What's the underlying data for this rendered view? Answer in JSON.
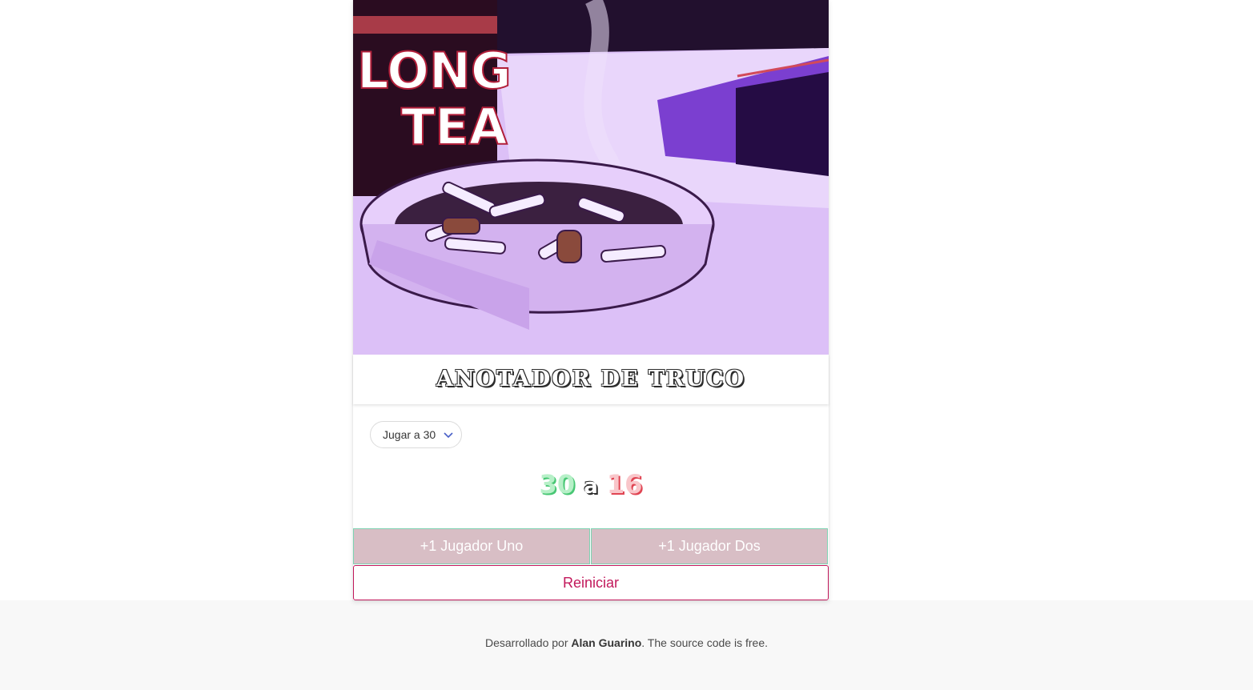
{
  "app": {
    "title": "ANOTADOR DE TRUCO",
    "hero_image_text": [
      "LONG",
      "TEA"
    ]
  },
  "game_mode": {
    "selected": "Jugar a 30"
  },
  "score": {
    "player_one": "30",
    "separator": "a",
    "player_two": "16"
  },
  "buttons": {
    "add_player_one": "+1 Jugador Uno",
    "add_player_two": "+1 Jugador Dos",
    "reset": "Reiniciar"
  },
  "footer": {
    "prefix": "Desarrollado por ",
    "author": "Alan Guarino",
    "suffix": ". The source code is free."
  },
  "colors": {
    "player_one": "#48c774",
    "player_two": "#e04452",
    "reset": "#c2185b",
    "button_bg": "#d8bec5"
  }
}
